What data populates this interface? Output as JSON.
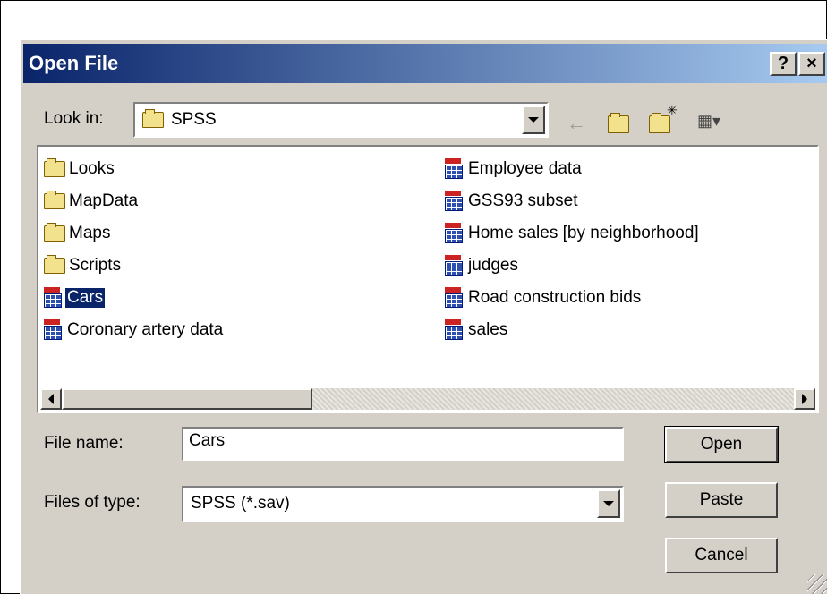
{
  "dialog": {
    "title": "Open File",
    "help_button": "?",
    "close_button": "×"
  },
  "lookin": {
    "label": "Look in:",
    "value": "SPSS",
    "icon": "folder-icon"
  },
  "toolbar": {
    "back_icon": "back-arrow-icon",
    "up_icon": "up-folder-icon",
    "new_folder_icon": "new-folder-icon",
    "view_icon": "view-menu-icon"
  },
  "files": {
    "col1": [
      {
        "name": "Looks",
        "type": "folder"
      },
      {
        "name": "MapData",
        "type": "folder"
      },
      {
        "name": "Maps",
        "type": "folder"
      },
      {
        "name": "Scripts",
        "type": "folder"
      },
      {
        "name": "Cars",
        "type": "data",
        "selected": true
      },
      {
        "name": "Coronary artery data",
        "type": "data"
      }
    ],
    "col2": [
      {
        "name": "Employee data",
        "type": "data"
      },
      {
        "name": "GSS93 subset",
        "type": "data"
      },
      {
        "name": "Home sales [by neighborhood]",
        "type": "data"
      },
      {
        "name": "judges",
        "type": "data"
      },
      {
        "name": "Road construction bids",
        "type": "data"
      },
      {
        "name": "sales",
        "type": "data"
      }
    ]
  },
  "filename": {
    "label": "File name:",
    "value": "Cars"
  },
  "filetype": {
    "label": "Files of type:",
    "value": "SPSS (*.sav)"
  },
  "buttons": {
    "open": "Open",
    "paste": "Paste",
    "cancel": "Cancel"
  },
  "colors": {
    "title_start": "#0a246a",
    "title_end": "#a6caf0",
    "dialog_bg": "#d4d0c8",
    "selection": "#0a246a"
  }
}
